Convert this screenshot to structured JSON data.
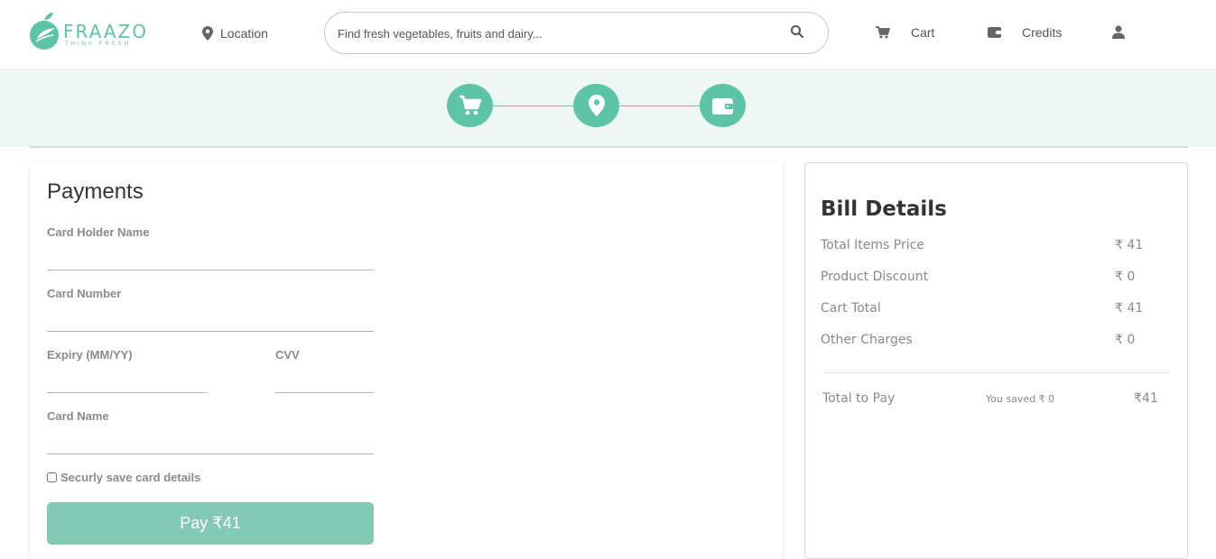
{
  "header": {
    "logo": {
      "name": "FRAAZO",
      "tagline": "THINK FRESH",
      "icon": "leaf-logo-icon"
    },
    "location": {
      "label": "Location",
      "icon": "map-pin-icon"
    },
    "search": {
      "placeholder": "Find fresh vegetables, fruits and dairy...",
      "value": "",
      "icon": "search-icon"
    },
    "nav": {
      "cart": {
        "label": "Cart",
        "icon": "cart-icon"
      },
      "credits": {
        "label": "Credits",
        "icon": "wallet-icon"
      },
      "account": {
        "icon": "user-icon"
      }
    }
  },
  "steps": [
    {
      "icon": "cart-icon"
    },
    {
      "icon": "map-pin-icon"
    },
    {
      "icon": "wallet-icon"
    }
  ],
  "payments": {
    "title": "Payments",
    "fields": {
      "card_holder_name": {
        "label": "Card Holder Name",
        "value": ""
      },
      "card_number": {
        "label": "Card Number",
        "value": ""
      },
      "expiry": {
        "label": "Expiry (MM/YY)",
        "value": ""
      },
      "cvv": {
        "label": "CVV",
        "value": ""
      },
      "card_name": {
        "label": "Card Name",
        "value": ""
      }
    },
    "save_card": {
      "label": "Securly save card details",
      "checked": false
    },
    "pay_button": "Pay ₹41"
  },
  "bill": {
    "title": "Bill Details",
    "rows": [
      {
        "label": "Total Items Price",
        "value": "₹ 41"
      },
      {
        "label": "Product Discount",
        "value": "₹ 0"
      },
      {
        "label": "Cart Total",
        "value": "₹ 41"
      },
      {
        "label": "Other Charges",
        "value": "₹ 0"
      }
    ],
    "total_label": "Total to Pay",
    "saved": "You saved ₹ 0",
    "total_value": "₹41"
  },
  "colors": {
    "accent": "#5ec4a7",
    "pay_button": "#84c8b6",
    "band": "#eef7f4"
  }
}
